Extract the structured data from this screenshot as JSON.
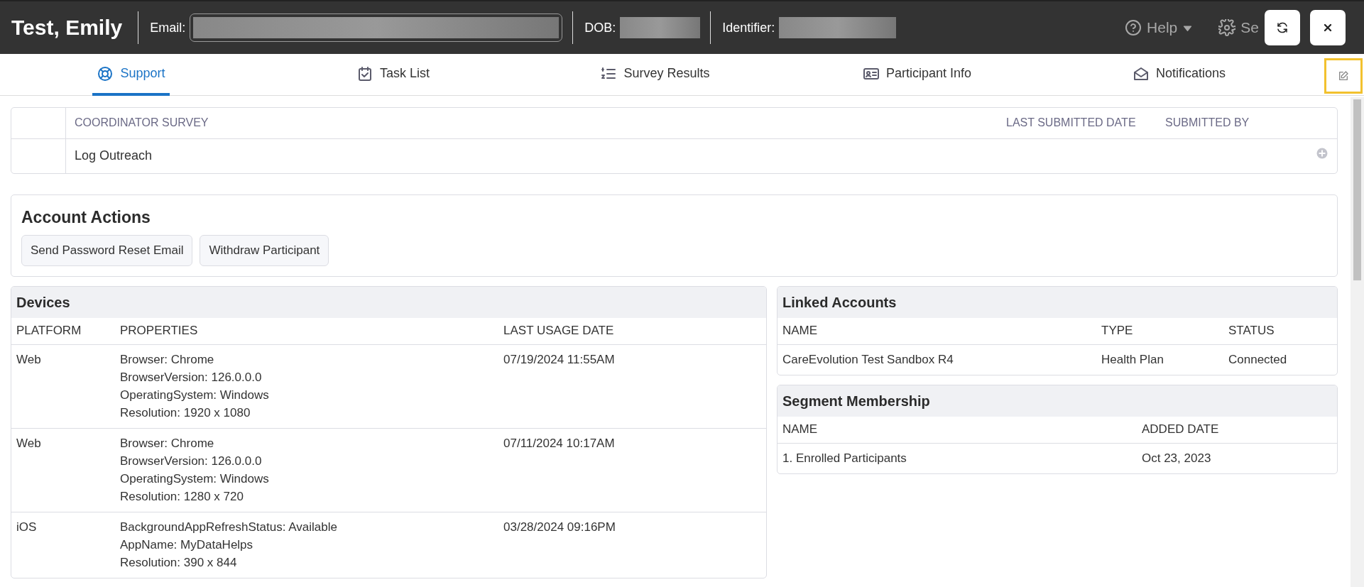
{
  "header": {
    "name": "Test, Emily",
    "fields": [
      {
        "label": "Email:"
      },
      {
        "label": "DOB:"
      },
      {
        "label": "Identifier:"
      }
    ],
    "background_menu": [
      "Help",
      "Se"
    ]
  },
  "tabs": [
    {
      "label": "Support",
      "selected": true
    },
    {
      "label": "Task List",
      "selected": false
    },
    {
      "label": "Survey Results",
      "selected": false
    },
    {
      "label": "Participant Info",
      "selected": false
    },
    {
      "label": "Notifications",
      "selected": false
    }
  ],
  "surveys": {
    "columns": [
      "COORDINATOR SURVEY",
      "LAST SUBMITTED DATE",
      "SUBMITTED BY"
    ],
    "rows": [
      {
        "survey": "Log Outreach"
      }
    ]
  },
  "account_actions": {
    "title": "Account Actions",
    "buttons": [
      "Send Password Reset Email",
      "Withdraw Participant"
    ]
  },
  "devices": {
    "title": "Devices",
    "columns": [
      "PLATFORM",
      "PROPERTIES",
      "LAST USAGE DATE"
    ],
    "rows": [
      {
        "platform": "Web",
        "properties": [
          "Browser: Chrome",
          "BrowserVersion: 126.0.0.0",
          "OperatingSystem: Windows",
          "Resolution: 1920 x 1080"
        ],
        "last_usage": "07/19/2024 11:55AM"
      },
      {
        "platform": "Web",
        "properties": [
          "Browser: Chrome",
          "BrowserVersion: 126.0.0.0",
          "OperatingSystem: Windows",
          "Resolution: 1280 x 720"
        ],
        "last_usage": "07/11/2024 10:17AM"
      },
      {
        "platform": "iOS",
        "properties": [
          "BackgroundAppRefreshStatus: Available",
          "AppName: MyDataHelps",
          "Resolution: 390 x 844"
        ],
        "last_usage": "03/28/2024 09:16PM"
      }
    ]
  },
  "linked_accounts": {
    "title": "Linked Accounts",
    "columns": [
      "NAME",
      "TYPE",
      "STATUS"
    ],
    "rows": [
      [
        "CareEvolution Test Sandbox R4",
        "Health Plan",
        "Connected"
      ]
    ]
  },
  "segment_membership": {
    "title": "Segment Membership",
    "columns": [
      "NAME",
      "ADDED DATE"
    ],
    "rows": [
      [
        "1. Enrolled Participants",
        "Oct 23, 2023"
      ]
    ]
  }
}
